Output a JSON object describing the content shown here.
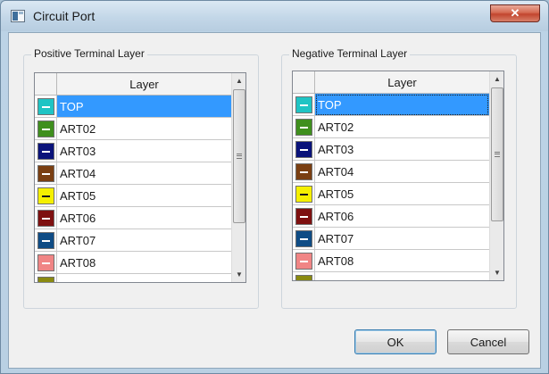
{
  "window": {
    "title": "Circuit Port",
    "close_glyph": "✕",
    "icon": "app-window-icon"
  },
  "positive": {
    "label": "Positive Terminal Layer",
    "column_header": "Layer",
    "selected_index": 0,
    "rows": [
      {
        "name": "TOP",
        "color": "#1fc4c4"
      },
      {
        "name": "ART02",
        "color": "#3f8f1e"
      },
      {
        "name": "ART03",
        "color": "#0a137a"
      },
      {
        "name": "ART04",
        "color": "#7a3f12"
      },
      {
        "name": "ART05",
        "color": "#f5f000"
      },
      {
        "name": "ART06",
        "color": "#7e1010"
      },
      {
        "name": "ART07",
        "color": "#0f4c85"
      },
      {
        "name": "ART08",
        "color": "#f08585"
      },
      {
        "name": "",
        "color": "#8a8a10"
      }
    ]
  },
  "negative": {
    "label": "Negative Terminal Layer",
    "column_header": "Layer",
    "selected_index": 0,
    "rows": [
      {
        "name": "TOP",
        "color": "#1fc4c4"
      },
      {
        "name": "ART02",
        "color": "#3f8f1e"
      },
      {
        "name": "ART03",
        "color": "#0a137a"
      },
      {
        "name": "ART04",
        "color": "#7a3f12"
      },
      {
        "name": "ART05",
        "color": "#f5f000"
      },
      {
        "name": "ART06",
        "color": "#7e1010"
      },
      {
        "name": "ART07",
        "color": "#0f4c85"
      },
      {
        "name": "ART08",
        "color": "#f08585"
      },
      {
        "name": "",
        "color": "#8a8a10"
      }
    ]
  },
  "buttons": {
    "ok": "OK",
    "cancel": "Cancel"
  },
  "scroll_arrows": {
    "up": "▲",
    "down": "▼"
  }
}
